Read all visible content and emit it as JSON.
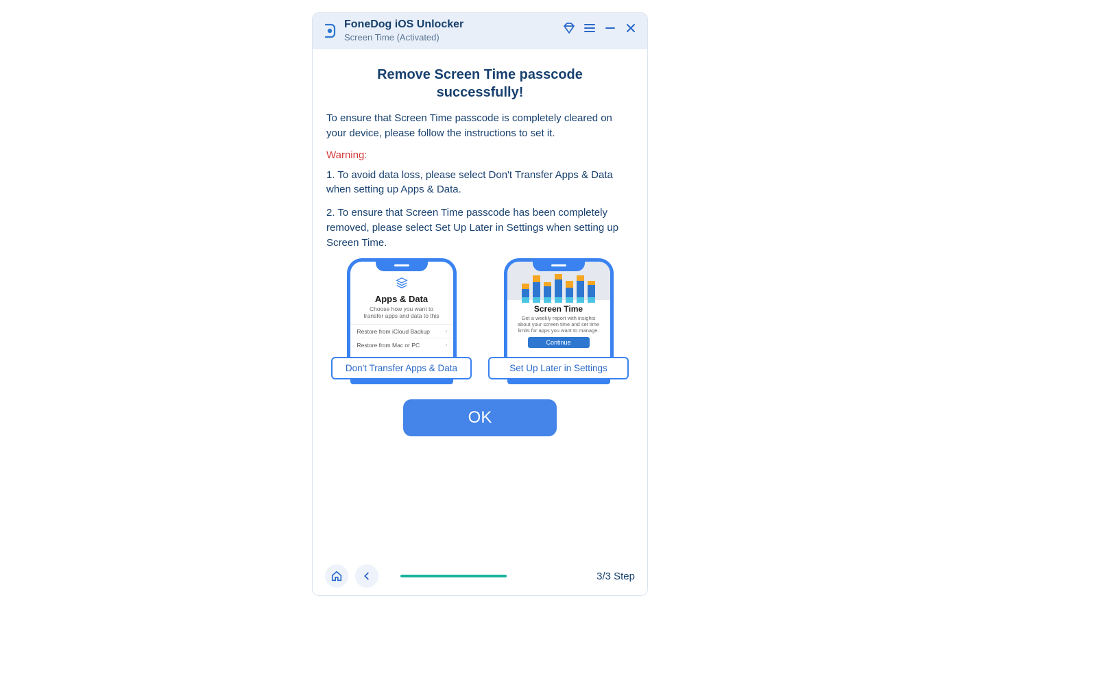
{
  "header": {
    "app_title": "FoneDog iOS Unlocker",
    "subtitle": "Screen Time  (Activated)"
  },
  "main": {
    "heading": "Remove Screen Time passcode successfully!",
    "intro": "To ensure that Screen Time passcode is completely cleared on your device, please follow the instructions to set it.",
    "warning_label": "Warning:",
    "warning1": "1. To avoid data loss, please select Don't Transfer Apps & Data when setting up Apps & Data.",
    "warning2": "2. To ensure that Screen Time passcode has been completely removed, please select Set Up Later in Settings when setting up Screen Time.",
    "ok_label": "OK"
  },
  "phone1": {
    "title": "Apps & Data",
    "sub": "Choose how you want to transfer apps and data to this",
    "opt1": "Restore from iCloud Backup",
    "opt2": "Restore from Mac or PC",
    "badge": "Don't Transfer Apps & Data"
  },
  "phone2": {
    "title": "Screen Time",
    "sub": "Get a weekly report with insights about your screen time and set time limits for apps you want to manage.",
    "continue": "Continue",
    "badge": "Set Up Later in Settings"
  },
  "footer": {
    "step": "3/3 Step",
    "progress_percent": 60
  }
}
